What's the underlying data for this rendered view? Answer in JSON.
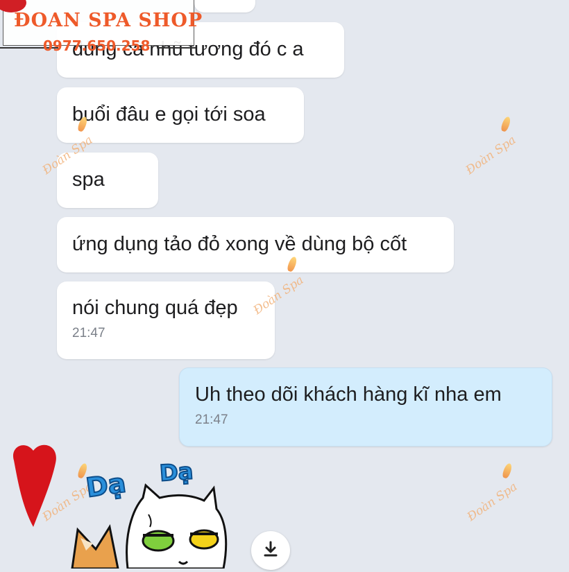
{
  "watermark": {
    "shop_name": "ĐOAN SPA SHOP",
    "phone": "0977.650.258",
    "logo_text": "Đoàn Spa"
  },
  "messages": [
    {
      "direction": "in",
      "text": "dùng cả nhũ tương đó c a"
    },
    {
      "direction": "in",
      "text": "buổi đâu e gọi tới soa"
    },
    {
      "direction": "in",
      "text": "spa"
    },
    {
      "direction": "in",
      "text": "ứng dụng tảo đỏ xong về dùng bộ cốt"
    },
    {
      "direction": "in",
      "text": "nói chung quá đẹp",
      "time": "21:47"
    },
    {
      "direction": "out",
      "text": "Uh theo dõi khách hàng kĩ nha em",
      "time": "21:47"
    }
  ],
  "sticker": {
    "text_1": "Dạ",
    "text_2": "Dạ"
  },
  "icons": {
    "download": "download-icon"
  },
  "colors": {
    "background": "#e4e8ef",
    "incoming_bubble": "#ffffff",
    "outgoing_bubble": "#d3edfd",
    "shop_brand": "#ee5a2a",
    "watermark": "#f2b27a"
  }
}
